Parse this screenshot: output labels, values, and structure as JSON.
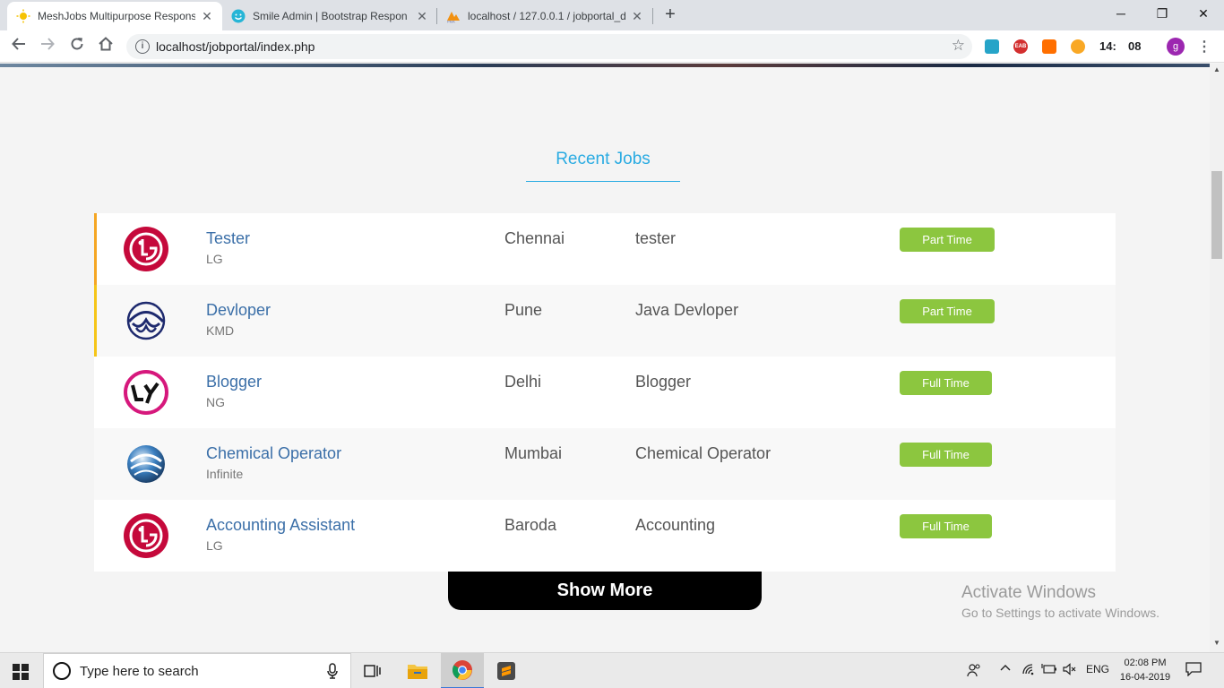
{
  "browser": {
    "tabs": [
      {
        "title": "MeshJobs Multipurpose Respons",
        "favicon": "sun-icon",
        "active": true
      },
      {
        "title": "Smile Admin | Bootstrap Respon",
        "favicon": "smile-icon",
        "active": false
      },
      {
        "title": "localhost / 127.0.0.1 / jobportal_d",
        "favicon": "phpmyadmin-icon",
        "active": false
      }
    ],
    "url": "localhost/jobportal/index.php",
    "clock_hour": "14:",
    "clock_min": "08",
    "profile_initial": "g",
    "ext_label": "EAB"
  },
  "page": {
    "section_title": "Recent Jobs",
    "jobs": [
      {
        "title": "Tester",
        "company": "LG",
        "location": "Chennai",
        "role": "tester",
        "type": "Part Time",
        "logo": "lg-logo-icon",
        "accent": "#f5a623"
      },
      {
        "title": "Devloper",
        "company": "KMD",
        "location": "Pune",
        "role": "Java Devloper",
        "type": "Part Time",
        "logo": "kmd-logo-icon",
        "accent": "#f5c518"
      },
      {
        "title": "Blogger",
        "company": "NG",
        "location": "Delhi",
        "role": "Blogger",
        "type": "Full Time",
        "logo": "ly-logo-icon",
        "accent": ""
      },
      {
        "title": "Chemical Operator",
        "company": "Infinite",
        "location": "Mumbai",
        "role": "Chemical Operator",
        "type": "Full Time",
        "logo": "infinite-logo-icon",
        "accent": ""
      },
      {
        "title": "Accounting Assistant",
        "company": "LG",
        "location": "Baroda",
        "role": "Accounting",
        "type": "Full Time",
        "logo": "lg-logo-icon",
        "accent": ""
      }
    ],
    "show_more": "Show More",
    "watermark_title": "Activate Windows",
    "watermark_sub": "Go to Settings to activate Windows."
  },
  "taskbar": {
    "search_placeholder": "Type here to search",
    "language": "ENG",
    "time": "02:08 PM",
    "date": "16-04-2019"
  },
  "colors": {
    "accent": "#2aabe2",
    "badge": "#8cc63f",
    "title_link": "#3b6fa8"
  }
}
